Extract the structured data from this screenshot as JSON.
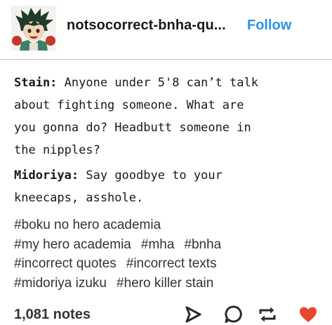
{
  "header": {
    "blog_name": "notsocorrect-bnha-qu...",
    "follow_label": "Follow",
    "avatar_icon": "deku-avatar"
  },
  "quotes": [
    {
      "speaker": "Stain:",
      "lines": [
        "Anyone under 5'8 can’t talk",
        "about fighting someone. What are",
        "you gonna do? Headbutt someone in",
        "the nipples?"
      ]
    },
    {
      "speaker": "Midoriya:",
      "lines": [
        "Say goodbye to your",
        "kneecaps, asshole."
      ]
    }
  ],
  "tags": [
    [
      "#boku no hero academia"
    ],
    [
      "#my hero academia",
      "#mha",
      "#bnha"
    ],
    [
      "#incorrect quotes",
      "#incorrect texts"
    ],
    [
      "#midoriya izuku",
      "#hero killer stain"
    ]
  ],
  "footer": {
    "notes": "1,081 notes",
    "icons": [
      "share-icon",
      "reply-icon",
      "reblog-icon",
      "like-icon"
    ],
    "like_color": "#e8472f"
  },
  "colors": {
    "follow": "#2e91ea",
    "text": "#1a1a1a"
  }
}
